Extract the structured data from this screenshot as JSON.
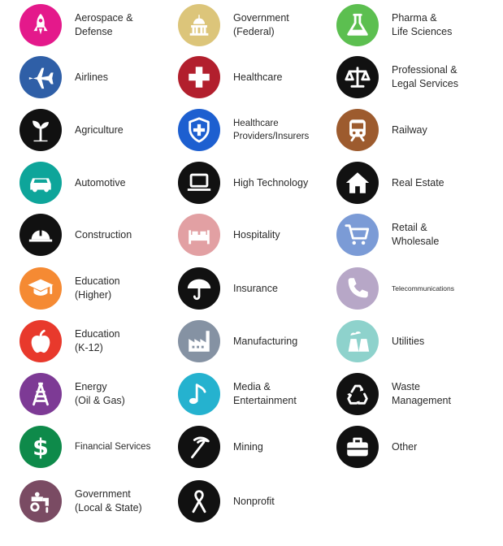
{
  "industries": [
    {
      "label": "Aerospace &\nDefense",
      "color": "#e4198b",
      "icon": "rocket-icon"
    },
    {
      "label": "Airlines",
      "color": "#2f5fa7",
      "icon": "airplane-icon"
    },
    {
      "label": "Agriculture",
      "color": "#111111",
      "icon": "sprout-icon"
    },
    {
      "label": "Automotive",
      "color": "#0ea59a",
      "icon": "car-icon"
    },
    {
      "label": "Construction",
      "color": "#111111",
      "icon": "hard-hat-icon"
    },
    {
      "label": "Education\n(Higher)",
      "color": "#f58a33",
      "icon": "graduation-cap-icon"
    },
    {
      "label": "Education\n(K-12)",
      "color": "#e8392c",
      "icon": "apple-icon"
    },
    {
      "label": "Energy\n(Oil & Gas)",
      "color": "#7d3a95",
      "icon": "oil-derrick-icon"
    },
    {
      "label": "Financial Services",
      "color": "#0e8a4a",
      "icon": "dollar-icon"
    },
    {
      "label": "Government\n(Local & State)",
      "color": "#7a4b63",
      "icon": "water-tap-icon"
    },
    {
      "label": "Government\n(Federal)",
      "color": "#dcc57a",
      "icon": "capitol-icon"
    },
    {
      "label": "Healthcare",
      "color": "#b21f2d",
      "icon": "medical-cross-icon"
    },
    {
      "label": "Healthcare\nProviders/Insurers",
      "color": "#1d5fd0",
      "icon": "shield-cross-icon"
    },
    {
      "label": "High Technology",
      "color": "#111111",
      "icon": "laptop-icon"
    },
    {
      "label": "Hospitality",
      "color": "#e2a0a3",
      "icon": "bed-icon"
    },
    {
      "label": "Insurance",
      "color": "#111111",
      "icon": "umbrella-icon"
    },
    {
      "label": "Manufacturing",
      "color": "#8592a3",
      "icon": "factory-icon"
    },
    {
      "label": "Media &\nEntertainment",
      "color": "#25b2cf",
      "icon": "music-note-icon"
    },
    {
      "label": "Mining",
      "color": "#111111",
      "icon": "pickaxe-icon"
    },
    {
      "label": "Nonprofit",
      "color": "#111111",
      "icon": "ribbon-icon"
    },
    {
      "label": "Pharma &\nLife Sciences",
      "color": "#5cbf50",
      "icon": "flask-icon"
    },
    {
      "label": "Professional &\nLegal Services",
      "color": "#111111",
      "icon": "scales-icon"
    },
    {
      "label": "Railway",
      "color": "#9d5b2e",
      "icon": "train-icon"
    },
    {
      "label": "Real Estate",
      "color": "#111111",
      "icon": "house-icon"
    },
    {
      "label": "Retail &\nWholesale",
      "color": "#7b9bd6",
      "icon": "shopping-cart-icon"
    },
    {
      "label": "Telecommunications",
      "color": "#b7a7c7",
      "icon": "phone-icon"
    },
    {
      "label": "Utilities",
      "color": "#8ed2cc",
      "icon": "power-plant-icon"
    },
    {
      "label": "Waste\nManagement",
      "color": "#111111",
      "icon": "recycle-icon"
    },
    {
      "label": "Other",
      "color": "#111111",
      "icon": "briefcase-icon"
    }
  ]
}
